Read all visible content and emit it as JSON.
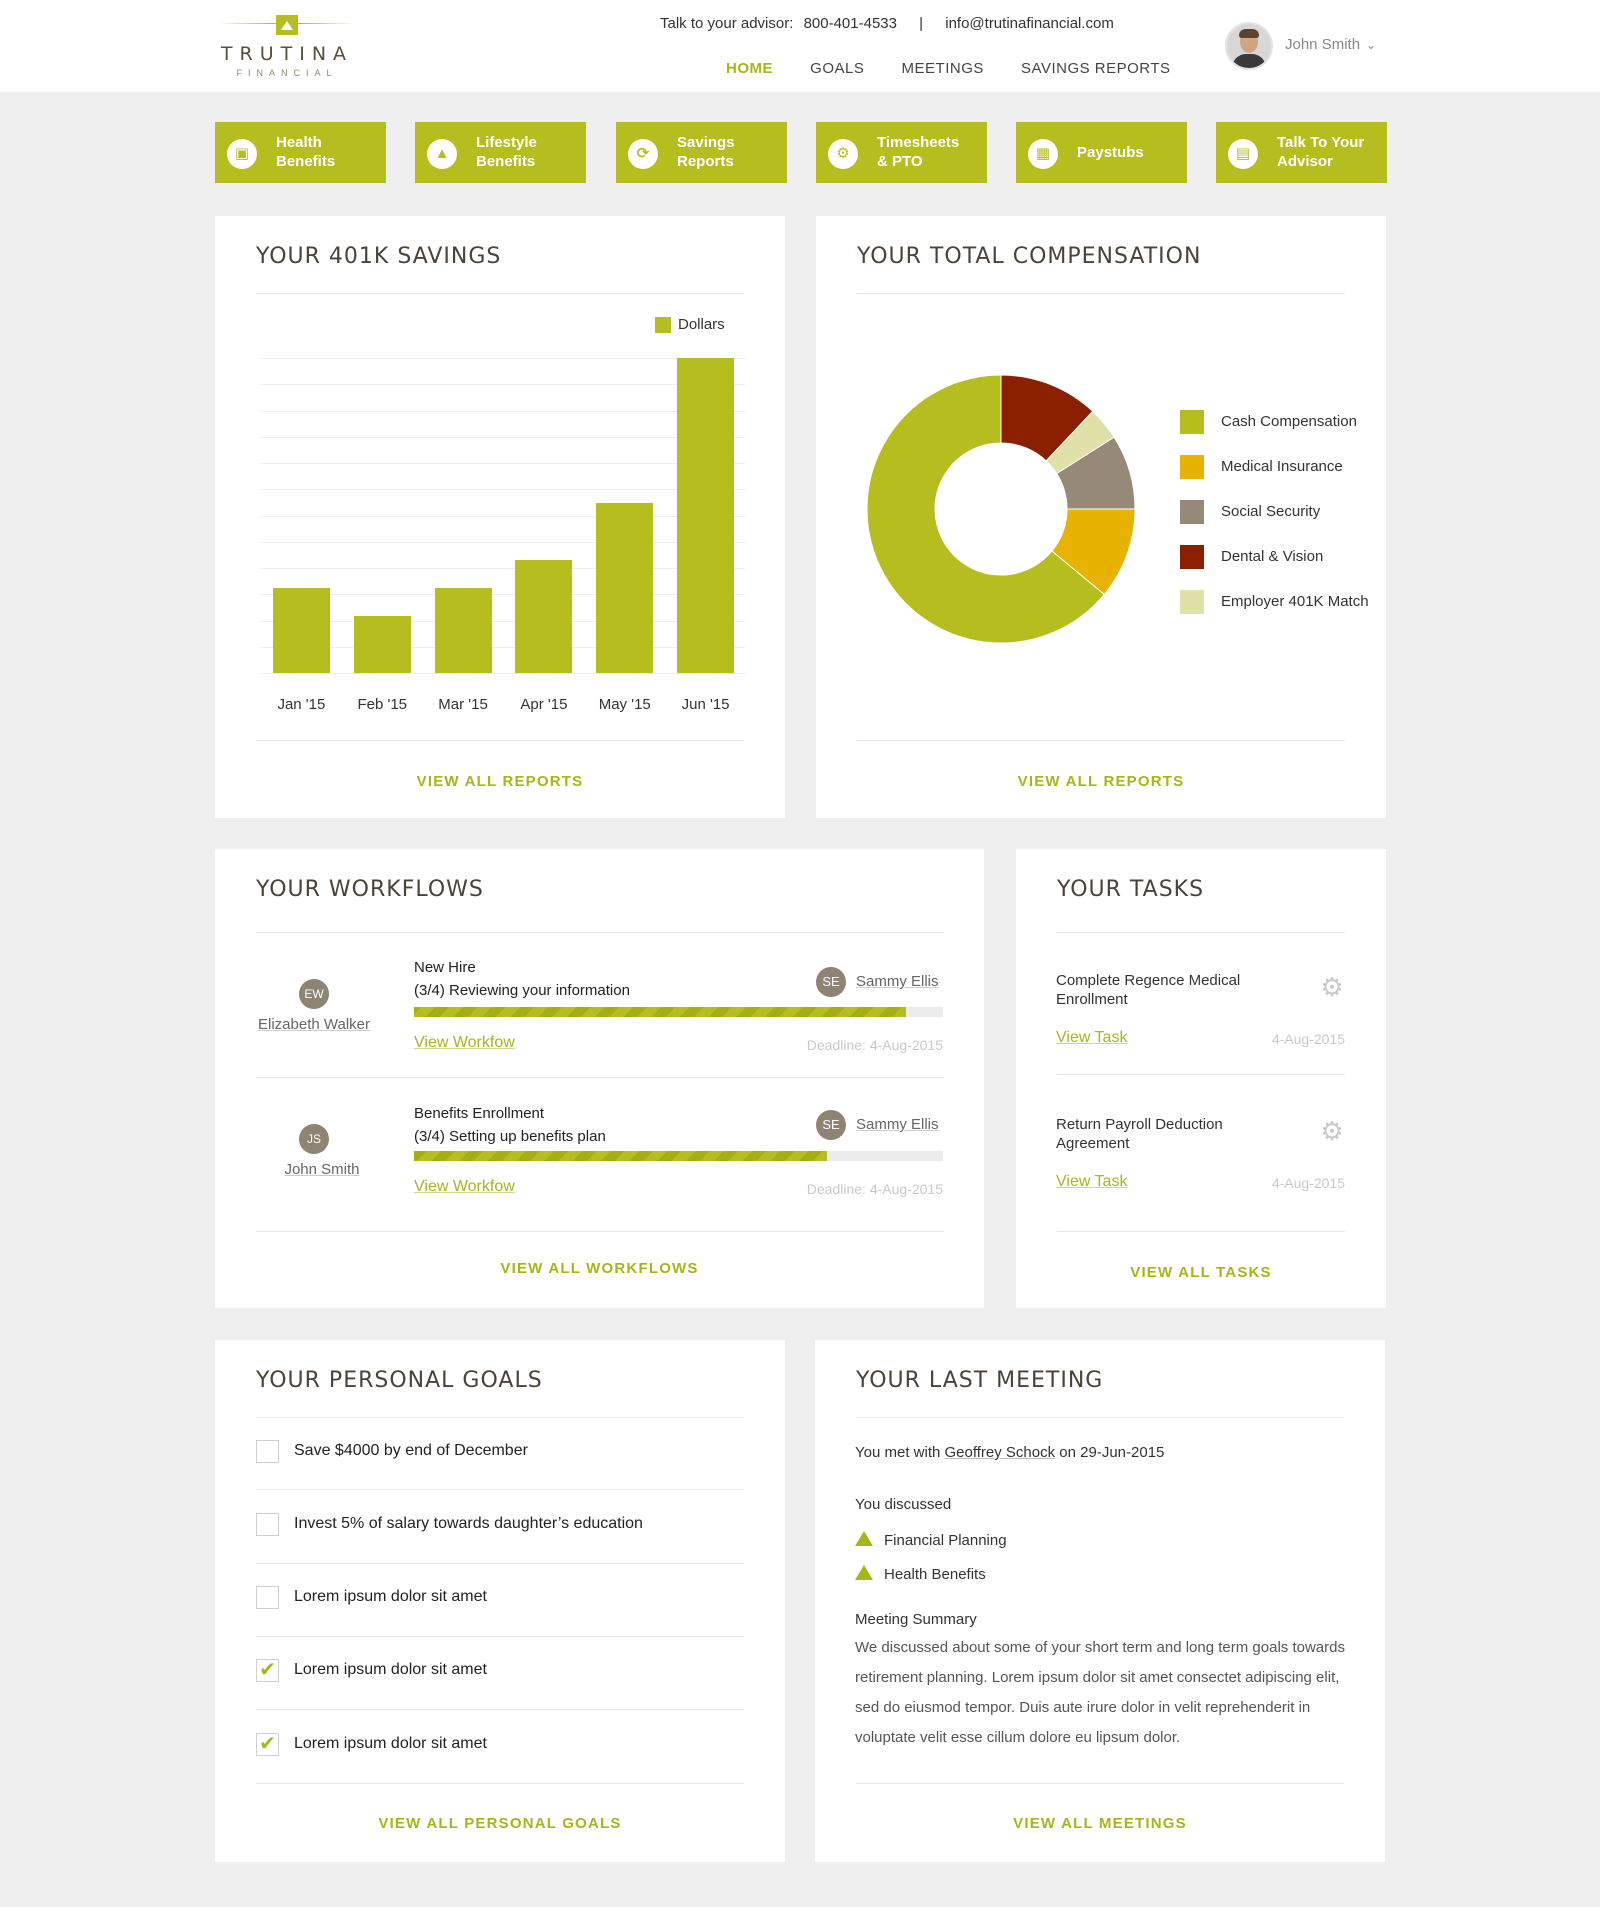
{
  "brand": {
    "name": "TRUTINA",
    "tagline": "FINANCIAL",
    "accent": "#b5bd1f"
  },
  "header": {
    "advisor_label": "Talk to your advisor:",
    "phone": "800-401-4533",
    "separator": "|",
    "email": "info@trutinafinancial.com",
    "nav": [
      "HOME",
      "GOALS",
      "MEETINGS",
      "SAVINGS REPORTS"
    ],
    "active_nav": "HOME",
    "user_name": "John Smith"
  },
  "quick_links": [
    {
      "label": "Health\nBenefits",
      "icon": "chat-icon"
    },
    {
      "label": "Lifestyle\nBenefits",
      "icon": "tree-icon"
    },
    {
      "label": "Savings\nReports",
      "icon": "refresh-icon"
    },
    {
      "label": "Timesheets\n& PTO",
      "icon": "gear-icon"
    },
    {
      "label": "Paystubs",
      "icon": "paystub-icon"
    },
    {
      "label": "Talk To Your\nAdvisor",
      "icon": "document-icon"
    }
  ],
  "savings_panel": {
    "title": "YOUR 401K SAVINGS",
    "link": "VIEW ALL REPORTS"
  },
  "compensation_panel": {
    "title": "YOUR TOTAL COMPENSATION",
    "link": "VIEW ALL REPORTS"
  },
  "chart_data": [
    {
      "type": "bar",
      "categories": [
        "Jan '15",
        "Feb '15",
        "Mar '15",
        "Apr '15",
        "May '15",
        "Jun '15"
      ],
      "series": [
        {
          "name": "Dollars",
          "values": [
            27,
            18,
            27,
            36,
            54,
            100
          ]
        }
      ],
      "ylim": [
        0,
        100
      ],
      "grid": true,
      "legend": "top-right",
      "color": "#b5bd1f"
    },
    {
      "type": "pie",
      "donut": true,
      "categories": [
        "Cash Compensation",
        "Medical Insurance",
        "Social Security",
        "Dental & Vision",
        "Employer 401K Match"
      ],
      "values": [
        64,
        11,
        9,
        12,
        4
      ],
      "colors": [
        "#b5bd1f",
        "#e8b200",
        "#968977",
        "#8b2000",
        "#dfe1a8"
      ],
      "legend": "right"
    }
  ],
  "workflows": {
    "title": "YOUR WORKFLOWS",
    "items": [
      {
        "initials": "EW",
        "person": "Elizabeth Walker",
        "title": "New Hire",
        "step": "(3/4) Reviewing your information",
        "progress": 0.93,
        "assignee_initials": "SE",
        "assignee": "Sammy Ellis",
        "link": "View Workfow",
        "deadline": "Deadline: 4-Aug-2015"
      },
      {
        "initials": "JS",
        "person": "John Smith",
        "title": "Benefits Enrollment",
        "step": "(3/4) Setting up benefits plan",
        "progress": 0.78,
        "assignee_initials": "SE",
        "assignee": "Sammy Ellis",
        "link": "View Workfow",
        "deadline": "Deadline: 4-Aug-2015"
      }
    ],
    "link": "VIEW ALL WORKFLOWS"
  },
  "tasks": {
    "title": "YOUR TASKS",
    "items": [
      {
        "title": "Complete Regence Medical Enrollment",
        "link": "View Task",
        "date": "4-Aug-2015"
      },
      {
        "title": "Return Payroll Deduction Agreement",
        "link": "View Task",
        "date": "4-Aug-2015"
      }
    ],
    "link": "VIEW ALL TASKS"
  },
  "goals": {
    "title": "YOUR PERSONAL GOALS",
    "items": [
      {
        "text": "Save $4000 by end of December",
        "checked": false
      },
      {
        "text": "Invest 5% of salary towards daughter’s education",
        "checked": false
      },
      {
        "text": "Lorem ipsum dolor sit amet",
        "checked": false
      },
      {
        "text": "Lorem ipsum dolor sit amet",
        "checked": true
      },
      {
        "text": "Lorem ipsum dolor sit amet",
        "checked": true
      }
    ],
    "link": "VIEW ALL PERSONAL GOALS"
  },
  "meeting": {
    "title": "YOUR LAST MEETING",
    "met_prefix": "You met with",
    "met_person": "Geoffrey Schock",
    "met_suffix": "on 29-Jun-2015",
    "discussed_label": "You discussed",
    "topics": [
      "Financial Planning",
      "Health Benefits"
    ],
    "summary_label": "Meeting Summary",
    "summary": "We discussed about some of your short term and long term goals towards retirement planning. Lorem ipsum dolor sit amet consectet adipiscing elit, sed do eiusmod tempor. Duis aute irure dolor in velit reprehenderit in voluptate velit esse cillum dolore eu lipsum dolor.",
    "link": "VIEW ALL MEETINGS"
  }
}
